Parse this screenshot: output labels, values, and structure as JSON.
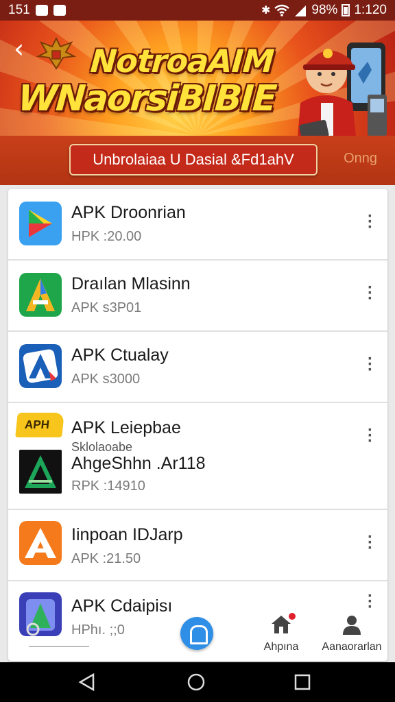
{
  "status_bar": {
    "time_left": "151",
    "battery": "98%",
    "clock": "1:120"
  },
  "banner": {
    "title_line1": "NotroaAIM",
    "title_line2": "WNaorsiBIBIE",
    "pill_text": "Unbrolaiaa U Dasial &Fd1ahV",
    "side_text": "Onng"
  },
  "apps": [
    {
      "title": "APK Droonrian",
      "subtitle": "HPK :20.00"
    },
    {
      "title": "Draılan Mlasinn",
      "subtitle": "APK s3P01"
    },
    {
      "title": "APK Ctualay",
      "subtitle": "APK s3000"
    },
    {
      "title": "APK Leiepbae",
      "tag": "Sklolaoabe",
      "title2": "AhgeShhn .Ar118",
      "subtitle": "RPK :14910"
    },
    {
      "title": "Iinpoan IDJarp",
      "subtitle": "APK :21.50"
    },
    {
      "title": "APK Cdaipisı",
      "subtitle": "HPhı. ;;0"
    }
  ],
  "apk_badge": "APH",
  "bottom_nav": {
    "home_label": "Ahpına",
    "profile_label": "Aanaorarlan"
  },
  "colors": {
    "header_red": "#7a1d12",
    "accent_blue": "#2f8fe6",
    "badge_red": "#e0202a"
  }
}
